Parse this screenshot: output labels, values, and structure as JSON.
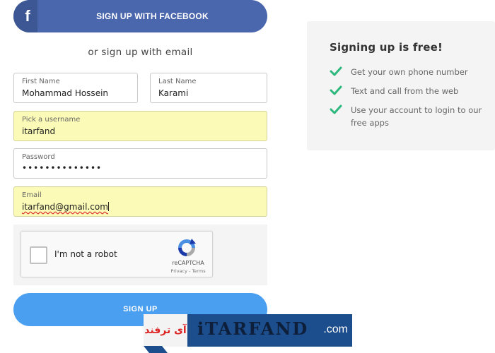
{
  "facebook": {
    "icon": "f",
    "label": "SIGN UP WITH FACEBOOK",
    "color": "#4a66ad"
  },
  "divider_text": "or sign up with email",
  "form": {
    "first_name": {
      "label": "First Name",
      "value": "Mohammad Hossein"
    },
    "last_name": {
      "label": "Last Name",
      "value": "Karami"
    },
    "username": {
      "label": "Pick a username",
      "value": "itarfand"
    },
    "password": {
      "label": "Password",
      "value": "••••••••••••••"
    },
    "email": {
      "label": "Email",
      "value": "itarfand@gmail.com"
    }
  },
  "captcha": {
    "label": "I'm not a robot",
    "brand": "reCAPTCHA",
    "links": "Privacy - Terms",
    "checked": false
  },
  "signup": {
    "label": "SIGN UP",
    "color": "#4b9ff0"
  },
  "benefits": {
    "title": "Signing up is free!",
    "items": [
      {
        "text": "Get your own phone number"
      },
      {
        "text": "Text and call from the web"
      },
      {
        "text": "Use your account to login to our free apps"
      }
    ],
    "check_color": "#2db87d"
  },
  "watermark": {
    "left_text": "آی ترفند",
    "logo_text": "iTARFAND",
    "suffix": ".com"
  }
}
